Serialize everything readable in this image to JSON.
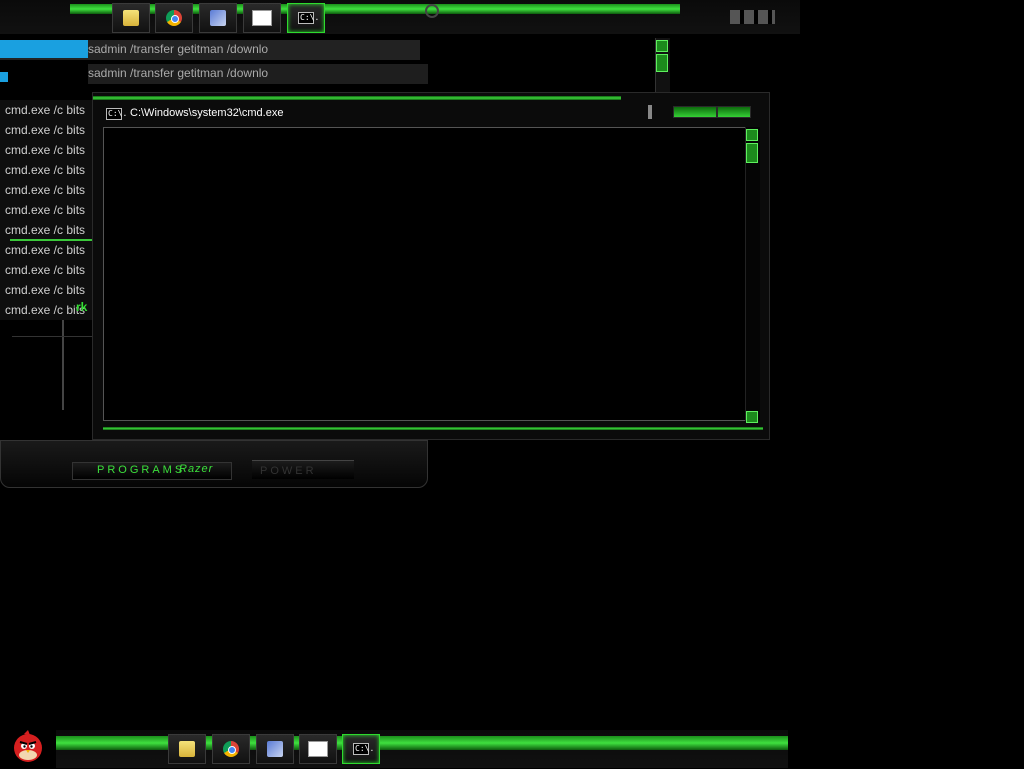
{
  "taskbar_top": {
    "buttons": [
      {
        "name": "explorer",
        "icon": "folder-icon"
      },
      {
        "name": "chrome",
        "icon": "chrome-icon"
      },
      {
        "name": "control-panel",
        "icon": "wrench-icon"
      },
      {
        "name": "on-screen-keyboard",
        "icon": "keyboard-icon"
      },
      {
        "name": "cmd",
        "icon": "cmd-icon",
        "glyph": "C:\\."
      }
    ]
  },
  "back_window": {
    "header_lines": [
      "sadmin /transfer getitman /downlo",
      "sadmin /transfer getitman /downlo"
    ],
    "lines": [
      "cmd.exe /c bits",
      "cmd.exe /c bits",
      "cmd.exe /c bits",
      "cmd.exe /c bits",
      "cmd.exe /c bits",
      "cmd.exe /c bits",
      "cmd.exe /c bits",
      "cmd.exe /c bits",
      "cmd.exe /c bits",
      "cmd.exe /c bits",
      "cmd.exe /c bits"
    ],
    "fragment": "rk"
  },
  "cmd_window": {
    "title": "C:\\Windows\\system32\\cmd.exe",
    "icon_glyph": "C:\\."
  },
  "start_menu": {
    "programs_label": "PROGRAMS",
    "brand_label": "Razer",
    "power_label": "POWER"
  },
  "taskbar_bottom": {
    "buttons": [
      {
        "name": "explorer",
        "icon": "folder-icon"
      },
      {
        "name": "chrome",
        "icon": "chrome-icon"
      },
      {
        "name": "control-panel",
        "icon": "wrench-icon"
      },
      {
        "name": "on-screen-keyboard",
        "icon": "keyboard-icon"
      },
      {
        "name": "cmd",
        "icon": "cmd-icon",
        "glyph": "C:\\."
      }
    ]
  },
  "colors": {
    "accent": "#2edb2e",
    "background": "#000000"
  }
}
